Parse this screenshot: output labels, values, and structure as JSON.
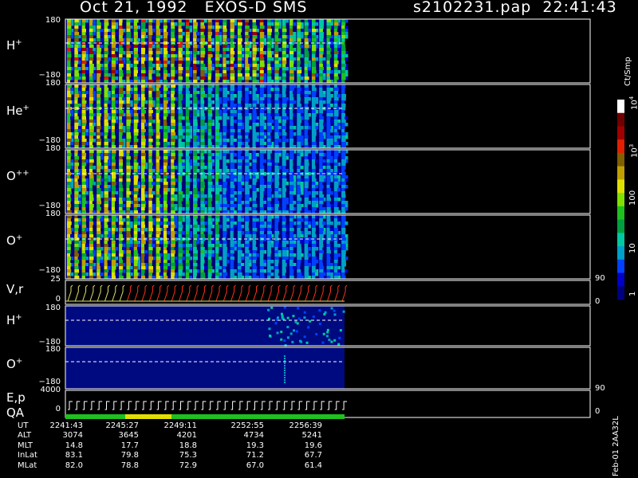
{
  "header": {
    "date": "Oct 21, 1992",
    "instrument": "EXOS-D SMS",
    "file": "s2102231.pap",
    "time": "22:41:43"
  },
  "panels": [
    {
      "id": "h-plus",
      "species": "H",
      "charge": "+",
      "ymax": "180",
      "ymin": "−180"
    },
    {
      "id": "he-plus",
      "species": "He",
      "charge": "+",
      "ymax": "180",
      "ymin": "−180"
    },
    {
      "id": "o-plusplus",
      "species": "O",
      "charge": "++",
      "ymax": "180",
      "ymin": "−180"
    },
    {
      "id": "o-plus",
      "species": "O",
      "charge": "+",
      "ymax": "180",
      "ymin": "−180"
    }
  ],
  "vr_panel": {
    "label": "V,r",
    "ymax": "25",
    "ymin": "0",
    "right_top": "90",
    "right_bottom": "0"
  },
  "low_panels": [
    {
      "id": "h-plus-low",
      "species": "H",
      "charge": "+",
      "ymax": "180",
      "ymin": "−180"
    },
    {
      "id": "o-plus-low",
      "species": "O",
      "charge": "+",
      "ymax": "180",
      "ymin": "−180"
    }
  ],
  "ep_panel": {
    "label1": "E,p",
    "label2": "QA",
    "ymax": "4000",
    "ymin": "0",
    "right_top": "90",
    "right_bottom": "0"
  },
  "colorbar": {
    "unit": "Ct/Smp",
    "ticks": [
      "1",
      "10",
      "100",
      "10",
      "10"
    ],
    "tick_sup": [
      "",
      "",
      "",
      "3",
      "4"
    ],
    "colors": [
      "#00007f",
      "#0000c8",
      "#0040ff",
      "#00a0c8",
      "#00c8a0",
      "#00a040",
      "#20c020",
      "#80e000",
      "#e0e000",
      "#c0a000",
      "#806000",
      "#e02000",
      "#a00000",
      "#700000",
      "#ffffff"
    ]
  },
  "bottom_table": {
    "rows": [
      {
        "label": "UT",
        "values": [
          "2241:43",
          "2245:27",
          "2249:11",
          "2252:55",
          "2256:39"
        ]
      },
      {
        "label": "ALT",
        "values": [
          "3074",
          "3645",
          "4201",
          "4734",
          "5241"
        ]
      },
      {
        "label": "MLT",
        "values": [
          "14.8",
          "17.7",
          "18.8",
          "19.3",
          "19.6"
        ]
      },
      {
        "label": "InLat",
        "values": [
          "83.1",
          "79.8",
          "75.3",
          "71.2",
          "67.7"
        ]
      },
      {
        "label": "MLat",
        "values": [
          "82.0",
          "78.8",
          "72.9",
          "67.0",
          "61.4"
        ]
      }
    ]
  },
  "footer_id": "Feb-01 2AA32L",
  "chart_data": {
    "type": "heatmap",
    "title": "Oct 21, 1992   EXOS-D SMS",
    "xlabel": "UT",
    "ylabel": "",
    "x_ticks": [
      "2241:43",
      "2245:27",
      "2249:11",
      "2252:55",
      "2256:39"
    ],
    "ylim": [
      -180,
      180
    ],
    "color_scale": "log",
    "color_range": [
      1,
      10000
    ],
    "series": [
      {
        "name": "H+",
        "pattern": "periodic spin-modulated bands, stronger early"
      },
      {
        "name": "He+",
        "pattern": "periodic bands fading after 2249"
      },
      {
        "name": "O++",
        "pattern": "periodic bands fading after 2249"
      },
      {
        "name": "O+",
        "pattern": "periodic bands fading after 2249"
      }
    ]
  }
}
